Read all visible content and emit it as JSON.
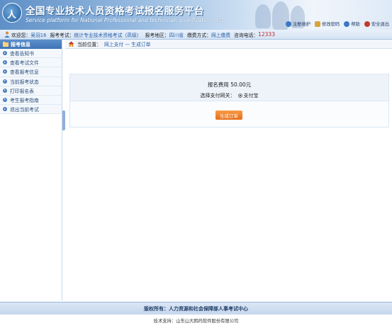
{
  "banner": {
    "title": "全国专业技术人员资格考试报名服务平台",
    "subtitle": "Service platform for National Professional and technician qualification test",
    "logo_text": "人",
    "links": [
      {
        "label": "注册维护",
        "icon": "user-edit-icon",
        "color": "#3b78c4"
      },
      {
        "label": "修改密码",
        "icon": "lock-icon",
        "color": "#d9a43a"
      },
      {
        "label": "帮助",
        "icon": "help-icon",
        "color": "#3b78c4"
      },
      {
        "label": "安全退出",
        "icon": "logout-icon",
        "color": "#c0392b"
      }
    ]
  },
  "infobar": {
    "welcome_label": "欢迎您：",
    "welcome_value": "吴羽16",
    "exam_label": "报考考试：",
    "exam_value": "统计专业技术资格考试（高级）",
    "region_label": "报考地区：",
    "region_value": "四川省",
    "payment_label": "缴费方式：",
    "payment_value": "网上缴费",
    "phone_label": "咨询电话：",
    "phone_value": "12333"
  },
  "sidebar": {
    "header": "报考信息",
    "items": [
      {
        "label": "查看告知书"
      },
      {
        "label": "查看考试文件"
      },
      {
        "label": "查看报考信息"
      },
      {
        "label": "当前报考状态"
      },
      {
        "label": "打印报名表"
      },
      {
        "label": "考生报考指南"
      },
      {
        "label": "退出当前考试"
      }
    ]
  },
  "breadcrumb": {
    "label": "当前位置：",
    "value": "网上支付 — 生成订单"
  },
  "order": {
    "fee_text": "报名费用 50.00元",
    "gateway_label": "选择支付网关：",
    "gateway_option": "支付宝",
    "button_label": "生成订单"
  },
  "footer": {
    "copyright": "版权所有：人力资源和社会保障部人事考试中心",
    "tech_support": "技术支持：山东山大鸥玛软件股份有限公司"
  },
  "colors": {
    "accent": "#3e74b5",
    "button": "#e86d16",
    "phone": "#c0282d"
  }
}
